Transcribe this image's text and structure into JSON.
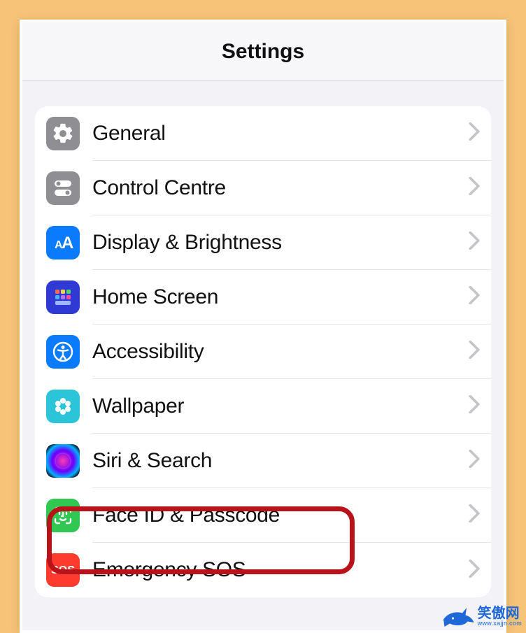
{
  "header": {
    "title": "Settings"
  },
  "items": [
    {
      "key": "general",
      "label": "General",
      "icon": "gear-icon"
    },
    {
      "key": "control",
      "label": "Control Centre",
      "icon": "toggles-icon"
    },
    {
      "key": "display",
      "label": "Display & Brightness",
      "icon": "text-size-icon"
    },
    {
      "key": "home",
      "label": "Home Screen",
      "icon": "app-grid-icon"
    },
    {
      "key": "access",
      "label": "Accessibility",
      "icon": "accessibility-icon"
    },
    {
      "key": "wall",
      "label": "Wallpaper",
      "icon": "flower-icon"
    },
    {
      "key": "siri",
      "label": "Siri & Search",
      "icon": "siri-icon"
    },
    {
      "key": "face",
      "label": "Face ID & Passcode",
      "icon": "face-id-icon"
    },
    {
      "key": "sos",
      "label": "Emergency SOS",
      "icon": "sos-icon"
    }
  ],
  "highlightedKey": "face",
  "watermark": {
    "main": "笑傲网",
    "sub": "www.xajjn.com"
  },
  "colors": {
    "page_bg": "#f6c478",
    "card_bg": "#f2f2f7",
    "row_bg": "#ffffff",
    "divider": "#e4e4e9",
    "chevron": "#c5c5c9",
    "highlight": "#b8121a"
  }
}
